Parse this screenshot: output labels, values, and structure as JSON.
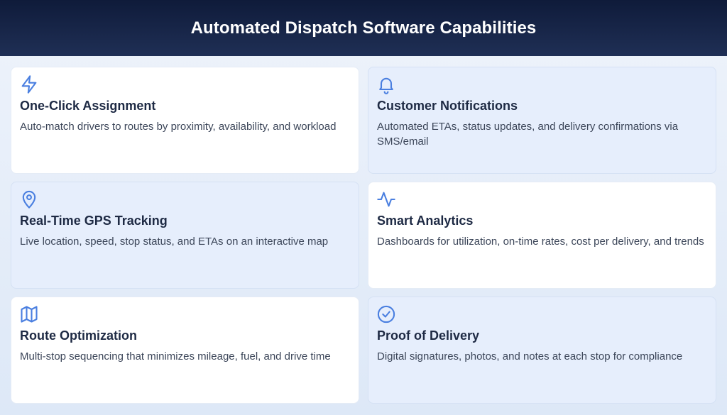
{
  "header": {
    "title": "Automated Dispatch Software Capabilities"
  },
  "colors": {
    "accent": "#4a7fe0",
    "header_bg": "#15224a",
    "card_tint": "#e6eefc"
  },
  "cards": [
    {
      "icon": "lightning-icon",
      "title": "One-Click Assignment",
      "description": "Auto-match drivers to routes by proximity, availability, and workload"
    },
    {
      "icon": "bell-icon",
      "title": "Customer Notifications",
      "description": "Automated ETAs, status updates, and delivery confirmations via SMS/email"
    },
    {
      "icon": "map-pin-icon",
      "title": "Real-Time GPS Tracking",
      "description": "Live location, speed, stop status, and ETAs on an interactive map"
    },
    {
      "icon": "activity-icon",
      "title": "Smart Analytics",
      "description": "Dashboards for utilization, on-time rates, cost per delivery, and trends"
    },
    {
      "icon": "map-icon",
      "title": "Route Optimization",
      "description": "Multi-stop sequencing that minimizes mileage, fuel, and drive time"
    },
    {
      "icon": "check-circle-icon",
      "title": "Proof of Delivery",
      "description": "Digital signatures, photos, and notes at each stop for compliance"
    }
  ]
}
